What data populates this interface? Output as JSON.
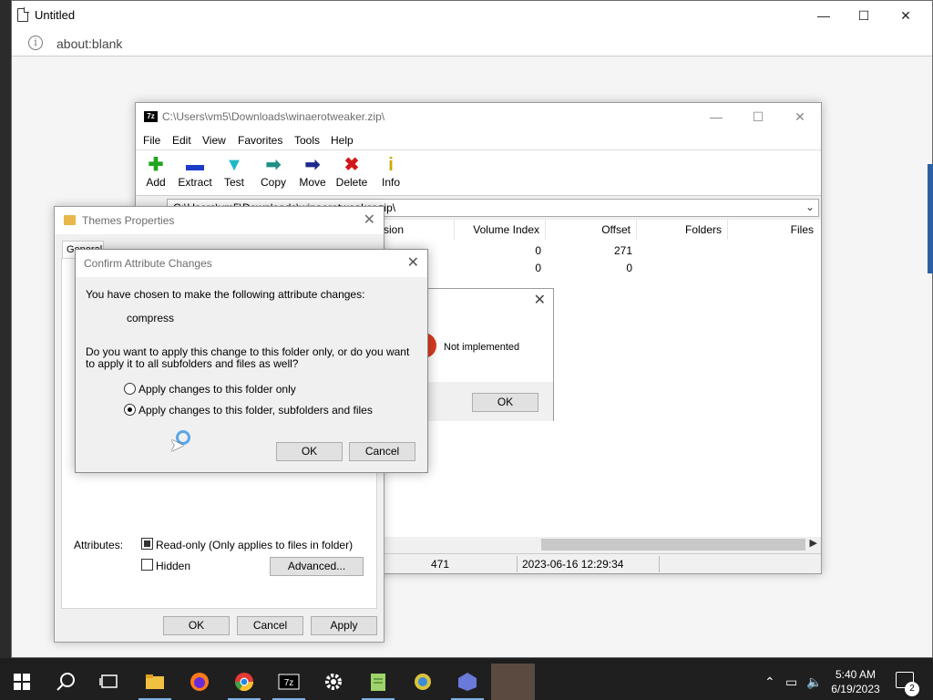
{
  "browser": {
    "title": "Untitled",
    "url": "about:blank",
    "controls": {
      "minimize": "—",
      "maximize": "☐",
      "close": "✕"
    }
  },
  "zip": {
    "title": "C:\\Users\\vm5\\Downloads\\winaerotweaker.zip\\",
    "controls": {
      "minimize": "—",
      "maximize": "☐",
      "close": "✕"
    },
    "menu": [
      "File",
      "Edit",
      "View",
      "Favorites",
      "Tools",
      "Help"
    ],
    "toolbar": {
      "add": "Add",
      "extract": "Extract",
      "test": "Test",
      "copy": "Copy",
      "move": "Move",
      "delete": "Delete",
      "info": "Info"
    },
    "path": "C:\\Users\\vm5\\Downloads\\winaerotweaker.zip\\",
    "columns": [
      "sion",
      "Volume Index",
      "Offset",
      "Folders",
      "Files"
    ],
    "rows": [
      {
        "volume_index": "0",
        "offset": "271"
      },
      {
        "volume_index": "0",
        "offset": "0"
      }
    ],
    "status": {
      "size": "471",
      "modified": "2023-06-16 12:29:34"
    }
  },
  "message": {
    "text": "Not implemented",
    "ok": "OK",
    "close": "✕"
  },
  "props": {
    "title": "Themes Properties",
    "tab": "General",
    "attributes_label": "Attributes:",
    "readonly": "Read-only (Only applies to files in folder)",
    "hidden": "Hidden",
    "advanced": "Advanced...",
    "ok": "OK",
    "cancel": "Cancel",
    "apply": "Apply",
    "close": "✕"
  },
  "confirm": {
    "title": "Confirm Attribute Changes",
    "intro": "You have chosen to make the following attribute changes:",
    "change": "compress",
    "question": "Do you want to apply this change to this folder only, or do you want to apply it to all subfolders and files as well?",
    "option_folder_only": "Apply changes to this folder only",
    "option_all": "Apply changes to this folder, subfolders and files",
    "selected_option": "option_all",
    "ok": "OK",
    "cancel": "Cancel",
    "close": "✕"
  },
  "taskbar": {
    "time": "5:40 AM",
    "date": "6/19/2023",
    "notifications": "2",
    "apps": [
      "start-icon",
      "search-icon",
      "task-view-icon",
      "file-explorer-icon",
      "firefox-icon",
      "chrome-icon",
      "7zip-icon",
      "settings-icon",
      "notepad-icon",
      "app-icon",
      "app-icon-2",
      "app-icon-3"
    ]
  }
}
